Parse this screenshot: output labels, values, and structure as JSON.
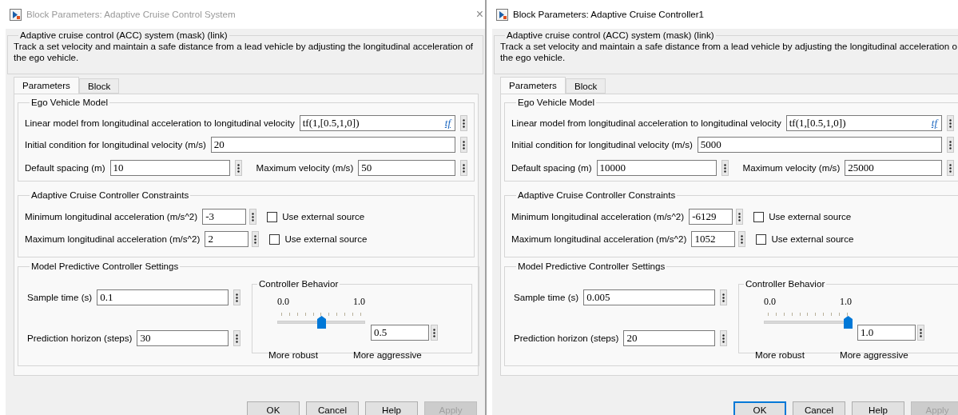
{
  "dialogs": [
    {
      "title": "Block Parameters: Adaptive Cruise Control System",
      "active": false,
      "close": "×",
      "mask_title": "Adaptive cruise control (ACC) system (mask) (link)",
      "description_lines": [
        "Track a set velocity and maintain a safe distance from a lead vehicle by adjusting the longitudinal acceleration of",
        "the ego vehicle."
      ],
      "tabs": [
        {
          "label": "Parameters",
          "selected": true
        },
        {
          "label": "Block",
          "selected": false
        }
      ],
      "ego_vehicle_model": {
        "title": "Ego Vehicle Model",
        "linear_model": {
          "label": "Linear model from longitudinal acceleration to longitudinal velocity",
          "value": "tf(1,[0.5,1,0])",
          "link": "tf"
        },
        "initial_condition": {
          "label": "Initial condition for longitudinal velocity (m/s)",
          "value": "20"
        },
        "default_spacing": {
          "label": "Default spacing (m)",
          "value": "10"
        },
        "maximum_velocity": {
          "label": "Maximum velocity (m/s)",
          "value": "50"
        }
      },
      "constraints": {
        "title": "Adaptive Cruise Controller Constraints",
        "rows": [
          {
            "label": "Minimum longitudinal acceleration (m/s^2)",
            "value": "-3",
            "checkbox": {
              "label": "Use external source",
              "checked": false
            }
          },
          {
            "label": "Maximum longitudinal acceleration (m/s^2)",
            "value": "2",
            "checkbox": {
              "label": "Use external source",
              "checked": false
            }
          }
        ]
      },
      "mpc_settings": {
        "title": "Model Predictive Controller Settings",
        "sample_time": {
          "label": "Sample time (s)",
          "value": "0.1"
        },
        "prediction_horizon": {
          "label": "Prediction horizon (steps)",
          "value": "30"
        },
        "controller_behavior": {
          "title": "Controller Behavior",
          "min_label": "0.0",
          "max_label": "1.0",
          "level": 0.5,
          "value": "0.5",
          "left_caption": "More robust",
          "right_caption": "More aggressive"
        }
      },
      "buttons": [
        {
          "label": "OK",
          "disabled": false,
          "focused": false
        },
        {
          "label": "Cancel",
          "disabled": false,
          "focused": false
        },
        {
          "label": "Help",
          "disabled": false,
          "focused": false
        },
        {
          "label": "Apply",
          "disabled": true,
          "focused": false
        }
      ]
    },
    {
      "title": "Block Parameters: Adaptive Cruise Controller1",
      "active": true,
      "mask_title": "Adaptive cruise control (ACC) system (mask) (link)",
      "description_lines": [
        "Track a set velocity and maintain a safe distance from a lead vehicle by adjusting the longitudinal acceleration o",
        "the ego vehicle."
      ],
      "tabs": [
        {
          "label": "Parameters",
          "selected": true
        },
        {
          "label": "Block",
          "selected": false
        }
      ],
      "ego_vehicle_model": {
        "title": "Ego Vehicle Model",
        "linear_model": {
          "label": "Linear model from longitudinal acceleration to longitudinal velocity",
          "value": "tf(1,[0.5,1,0])",
          "link": "tf"
        },
        "initial_condition": {
          "label": "Initial condition for longitudinal velocity (m/s)",
          "value": "5000"
        },
        "default_spacing": {
          "label": "Default spacing (m)",
          "value": "10000"
        },
        "maximum_velocity": {
          "label": "Maximum velocity (m/s)",
          "value": "25000"
        }
      },
      "constraints": {
        "title": "Adaptive Cruise Controller Constraints",
        "rows": [
          {
            "label": "Minimum longitudinal acceleration (m/s^2)",
            "value": "-6129",
            "checkbox": {
              "label": "Use external source",
              "checked": false
            }
          },
          {
            "label": "Maximum longitudinal acceleration (m/s^2)",
            "value": "1052",
            "checkbox": {
              "label": "Use external source",
              "checked": false
            }
          }
        ]
      },
      "mpc_settings": {
        "title": "Model Predictive Controller Settings",
        "sample_time": {
          "label": "Sample time (s)",
          "value": "0.005"
        },
        "prediction_horizon": {
          "label": "Prediction horizon (steps)",
          "value": "20"
        },
        "controller_behavior": {
          "title": "Controller Behavior",
          "min_label": "0.0",
          "max_label": "1.0",
          "level": 1.0,
          "value": "1.0",
          "left_caption": "More robust",
          "right_caption": "More aggressive"
        }
      },
      "buttons": [
        {
          "label": "OK",
          "disabled": false,
          "focused": true
        },
        {
          "label": "Cancel",
          "disabled": false,
          "focused": false
        },
        {
          "label": "Help",
          "disabled": false,
          "focused": false
        },
        {
          "label": "Apply",
          "disabled": true,
          "focused": false
        }
      ]
    }
  ]
}
